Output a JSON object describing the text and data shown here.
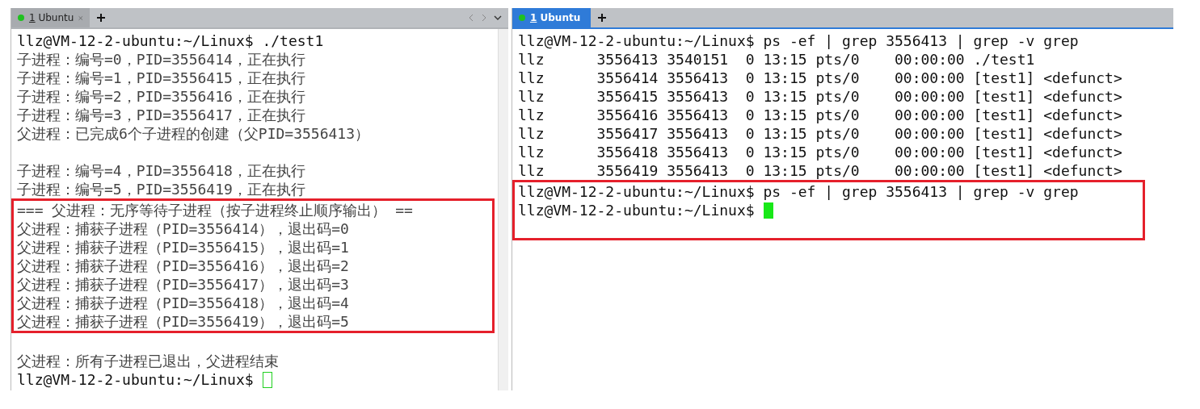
{
  "panes": [
    {
      "tab": {
        "label": "1 Ubuntu",
        "selected": false
      },
      "nav_controls": true,
      "blocks": [
        {
          "highlighted": false,
          "lines": [
            {
              "kind": "input",
              "text": "llz@VM-12-2-ubuntu:~/Linux$ ./test1"
            },
            {
              "kind": "output",
              "text": "子进程：编号=0，PID=3556414，正在执行"
            },
            {
              "kind": "output",
              "text": "子进程：编号=1，PID=3556415，正在执行"
            },
            {
              "kind": "output",
              "text": "子进程：编号=2，PID=3556416，正在执行"
            },
            {
              "kind": "output",
              "text": "子进程：编号=3，PID=3556417，正在执行"
            },
            {
              "kind": "output",
              "text": "父进程：已完成6个子进程的创建（父PID=3556413）"
            },
            {
              "kind": "blank"
            },
            {
              "kind": "output",
              "text": "子进程：编号=4，PID=3556418，正在执行"
            },
            {
              "kind": "output",
              "text": "子进程：编号=5，PID=3556419，正在执行"
            }
          ]
        },
        {
          "highlighted": true,
          "lines": [
            {
              "kind": "output",
              "text": "=== 父进程：无序等待子进程（按子进程终止顺序输出） =="
            },
            {
              "kind": "output",
              "text": "父进程：捕获子进程（PID=3556414），退出码=0"
            },
            {
              "kind": "output",
              "text": "父进程：捕获子进程（PID=3556415），退出码=1"
            },
            {
              "kind": "output",
              "text": "父进程：捕获子进程（PID=3556416），退出码=2"
            },
            {
              "kind": "output",
              "text": "父进程：捕获子进程（PID=3556417），退出码=3"
            },
            {
              "kind": "output",
              "text": "父进程：捕获子进程（PID=3556418），退出码=4"
            },
            {
              "kind": "output",
              "text": "父进程：捕获子进程（PID=3556419），退出码=5"
            }
          ]
        },
        {
          "highlighted": false,
          "lines": [
            {
              "kind": "blank"
            },
            {
              "kind": "output",
              "text": "父进程：所有子进程已退出，父进程结束"
            },
            {
              "kind": "prompt",
              "text": "llz@VM-12-2-ubuntu:~/Linux$",
              "cursor_filled": false
            }
          ]
        }
      ]
    },
    {
      "tab": {
        "label": "1 Ubuntu",
        "selected": true
      },
      "nav_controls": false,
      "blocks": [
        {
          "highlighted": false,
          "lines": [
            {
              "kind": "input",
              "text": "llz@VM-12-2-ubuntu:~/Linux$ ps -ef | grep 3556413 | grep -v grep"
            },
            {
              "kind": "input",
              "text": "llz      3556413 3540151  0 13:15 pts/0    00:00:00 ./test1"
            },
            {
              "kind": "input",
              "text": "llz      3556414 3556413  0 13:15 pts/0    00:00:00 [test1] <defunct>"
            },
            {
              "kind": "input",
              "text": "llz      3556415 3556413  0 13:15 pts/0    00:00:00 [test1] <defunct>"
            },
            {
              "kind": "input",
              "text": "llz      3556416 3556413  0 13:15 pts/0    00:00:00 [test1] <defunct>"
            },
            {
              "kind": "input",
              "text": "llz      3556417 3556413  0 13:15 pts/0    00:00:00 [test1] <defunct>"
            },
            {
              "kind": "input",
              "text": "llz      3556418 3556413  0 13:15 pts/0    00:00:00 [test1] <defunct>"
            },
            {
              "kind": "input",
              "text": "llz      3556419 3556413  0 13:15 pts/0    00:00:00 [test1] <defunct>"
            }
          ]
        },
        {
          "highlighted": true,
          "lines": [
            {
              "kind": "input",
              "text": "llz@VM-12-2-ubuntu:~/Linux$ ps -ef | grep 3556413 | grep -v grep"
            },
            {
              "kind": "prompt",
              "text": "llz@VM-12-2-ubuntu:~/Linux$",
              "cursor_filled": true
            },
            {
              "kind": "blank"
            }
          ]
        }
      ]
    }
  ]
}
